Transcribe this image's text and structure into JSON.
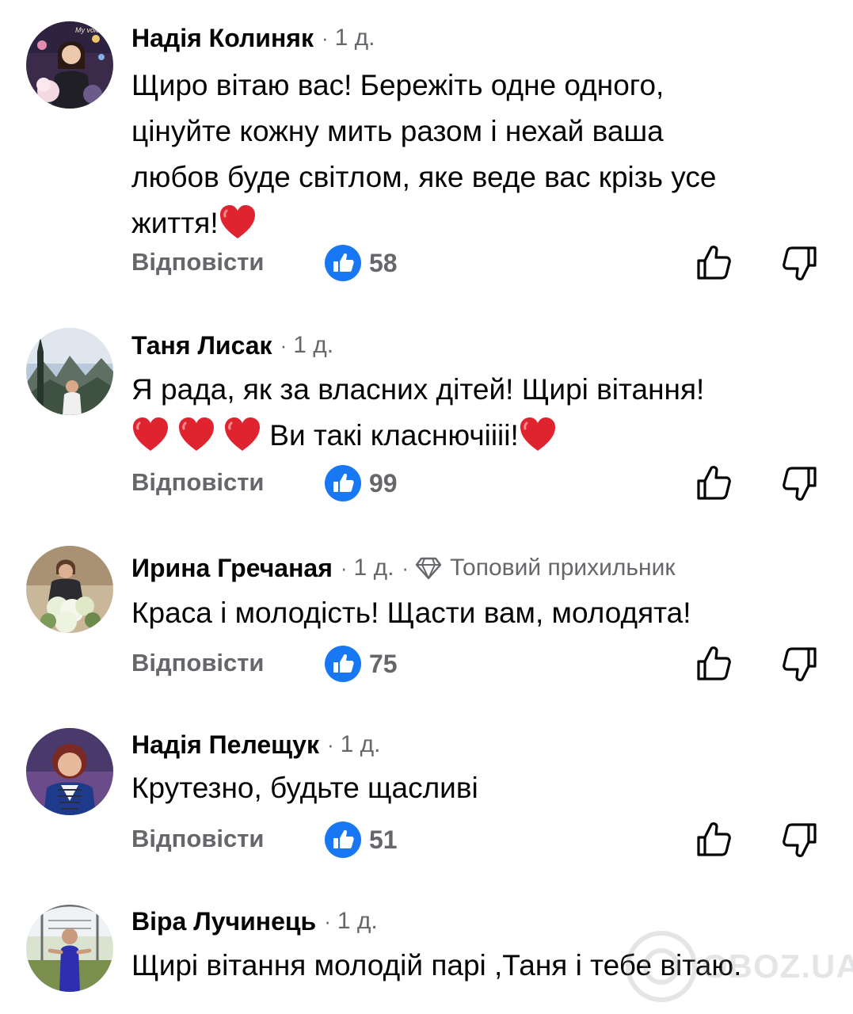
{
  "comments": [
    {
      "author": "Надія Колиняк",
      "time": "1 д.",
      "lines": [
        "Щиро вітаю вас! Бережіть одне одного,",
        "цінуйте кожну мить разом і нехай ваша",
        "любов буде світлом, яке веде вас крізь усе",
        "життя!"
      ],
      "reply_label": "Відповісти",
      "likes": "58"
    },
    {
      "author": "Таня Лисак",
      "time": "1 д.",
      "lines": [
        "Я рада, як за власних дітей! Щирі вітання!",
        "Ви такі класнючіііі!"
      ],
      "reply_label": "Відповісти",
      "likes": "99"
    },
    {
      "author": "Ирина Гречаная",
      "time": "1 д.",
      "badge": "Топовий прихильник",
      "lines": [
        "Краса і молодість! Щасти вам, молодята!"
      ],
      "reply_label": "Відповісти",
      "likes": "75"
    },
    {
      "author": "Надія Пелещук",
      "time": "1 д.",
      "lines": [
        "Крутезно, будьте щасливі"
      ],
      "reply_label": "Відповісти",
      "likes": "51"
    },
    {
      "author": "Віра Лучинець",
      "time": "1 д.",
      "lines": [
        "Щирі вітання молодій парі ,Таня і тебе вітаю."
      ]
    }
  ],
  "icons": {
    "like_badge": "like-badge-icon",
    "thumbs_up": "thumbs-up-icon",
    "thumbs_down": "thumbs-down-icon",
    "heart": "red-heart-emoji",
    "diamond": "diamond-icon"
  },
  "colors": {
    "like_blue": "#1877f2",
    "secondary_text": "#65676b",
    "heart_red": "#e0242f"
  },
  "watermark": "OBOZ.UA"
}
